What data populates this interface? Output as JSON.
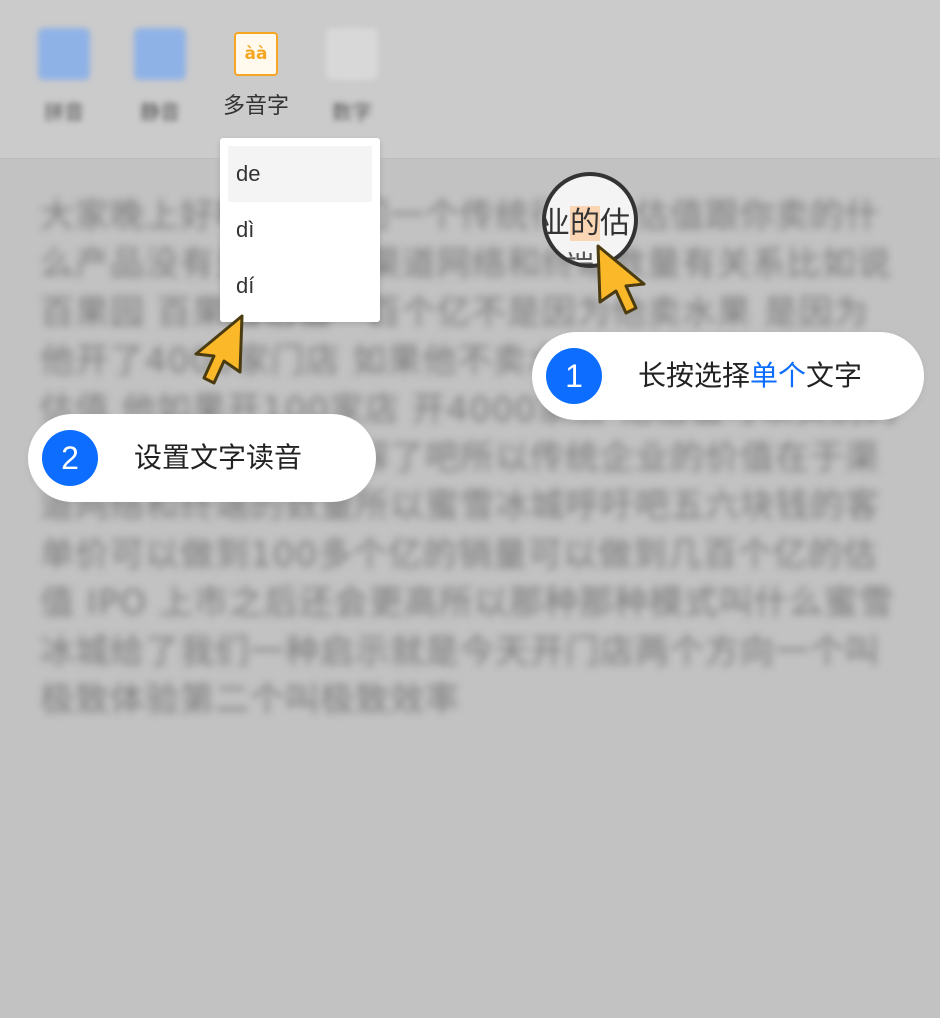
{
  "toolbar": {
    "items": [
      {
        "label": "拼音",
        "icon": "pinyin-icon",
        "color": "#8fb2e6"
      },
      {
        "label": "静音",
        "icon": "mute-icon",
        "color": "#8fb2e6"
      },
      {
        "label": "多音字",
        "icon": "polyphone-icon",
        "glyph": "àà",
        "color": "#f5a623"
      },
      {
        "label": "数字",
        "icon": "number-icon",
        "color": "#d8d8d8"
      }
    ]
  },
  "body_text": "大家晚上好啊现在我们一个传统行业的估值跟你卖的什么产品没有关系 跟你渠道网络和终端数量有关系比如说百果园 百果园估值一百个亿不是因为他卖水果 是因为他开了4000家门店 如果他不卖水果他卖别的也是这个估值 他如果开100家店 开4000家店 他估值可以卖别的 就可以到良品铺子理解了吧所以传统企业的价值在于渠道网络和终端的数量所以蜜雪冰城呼吁吧五六块钱的客单价可以做到100多个亿的销量可以做到几百个亿的估值 IPO 上市之后还会更高所以那种那种模式叫什么蜜雪冰城给了我们一种启示就是今天开门店两个方向一个叫极致体验第二个叫极致效率",
  "popup": {
    "options": [
      "de",
      "dì",
      "dí"
    ],
    "selected": "de"
  },
  "magnifier": {
    "line1_before": "业",
    "highlighted": "的",
    "line1_after": "估",
    "line2": "端"
  },
  "callouts": [
    {
      "number": "1",
      "text_before": "长按选择",
      "text_accent": "单个",
      "text_after": "文字"
    },
    {
      "number": "2",
      "text": "设置文字读音"
    }
  ],
  "colors": {
    "accent": "#0c6dff",
    "highlight": "#fbd6b5",
    "pointer": "#fbb829"
  }
}
